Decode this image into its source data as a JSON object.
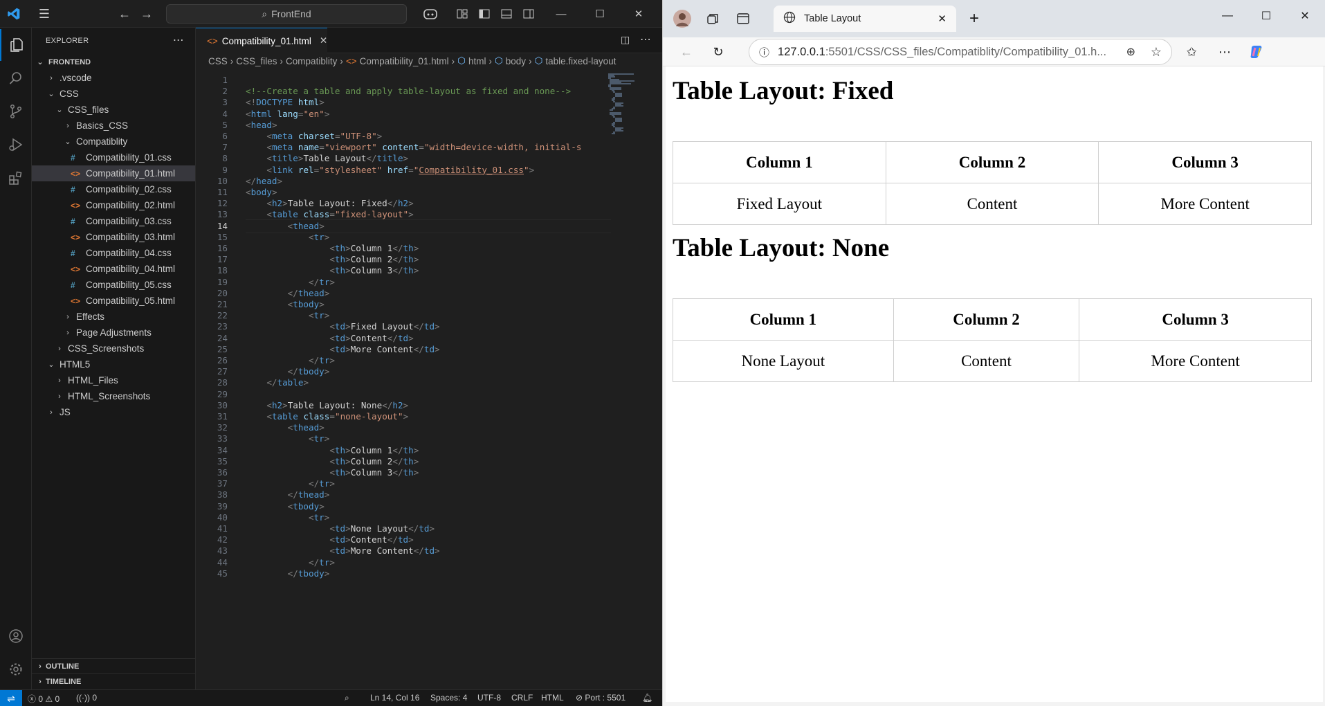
{
  "vscode": {
    "command_center": "FrontEnd",
    "explorer_title": "EXPLORER",
    "tree": [
      {
        "label": "FRONTEND",
        "level": 0,
        "type": "root",
        "chevron": "⌄"
      },
      {
        "label": ".vscode",
        "level": 1,
        "type": "folder",
        "chevron": "›"
      },
      {
        "label": "CSS",
        "level": 1,
        "type": "folder",
        "chevron": "⌄"
      },
      {
        "label": "CSS_files",
        "level": 2,
        "type": "folder",
        "chevron": "⌄"
      },
      {
        "label": "Basics_CSS",
        "level": 3,
        "type": "folder",
        "chevron": "›"
      },
      {
        "label": "Compatiblity",
        "level": 3,
        "type": "folder",
        "chevron": "⌄"
      },
      {
        "label": "Compatibility_01.css",
        "level": 4,
        "type": "css"
      },
      {
        "label": "Compatibility_01.html",
        "level": 4,
        "type": "html",
        "selected": true
      },
      {
        "label": "Compatibility_02.css",
        "level": 4,
        "type": "css"
      },
      {
        "label": "Compatibility_02.html",
        "level": 4,
        "type": "html"
      },
      {
        "label": "Compatibility_03.css",
        "level": 4,
        "type": "css"
      },
      {
        "label": "Compatibility_03.html",
        "level": 4,
        "type": "html"
      },
      {
        "label": "Compatibility_04.css",
        "level": 4,
        "type": "css"
      },
      {
        "label": "Compatibility_04.html",
        "level": 4,
        "type": "html"
      },
      {
        "label": "Compatibility_05.css",
        "level": 4,
        "type": "css"
      },
      {
        "label": "Compatibility_05.html",
        "level": 4,
        "type": "html"
      },
      {
        "label": "Effects",
        "level": 3,
        "type": "folder",
        "chevron": "›"
      },
      {
        "label": "Page Adjustments",
        "level": 3,
        "type": "folder",
        "chevron": "›"
      },
      {
        "label": "CSS_Screenshots",
        "level": 2,
        "type": "folder",
        "chevron": "›"
      },
      {
        "label": "HTML5",
        "level": 1,
        "type": "folder",
        "chevron": "⌄"
      },
      {
        "label": "HTML_Files",
        "level": 2,
        "type": "folder",
        "chevron": "›"
      },
      {
        "label": "HTML_Screenshots",
        "level": 2,
        "type": "folder",
        "chevron": "›"
      },
      {
        "label": "JS",
        "level": 1,
        "type": "folder",
        "chevron": "›"
      }
    ],
    "outline_label": "OUTLINE",
    "timeline_label": "TIMELINE",
    "tab_label": "Compatibility_01.html",
    "breadcrumbs": [
      "CSS",
      "CSS_files",
      "Compatiblity",
      "Compatibility_01.html",
      "html",
      "body",
      "table.fixed-layout"
    ],
    "current_line": 14,
    "code_lines": [
      "",
      "<!--Create a table and apply table-layout as fixed and none-->",
      "<!DOCTYPE html>",
      "<html lang=\"en\">",
      "<head>",
      "    <meta charset=\"UTF-8\">",
      "    <meta name=\"viewport\" content=\"width=device-width, initial-s",
      "    <title>Table Layout</title>",
      "    <link rel=\"stylesheet\" href=\"Compatibility_01.css\">",
      "</head>",
      "<body>",
      "    <h2>Table Layout: Fixed</h2>",
      "    <table class=\"fixed-layout\">",
      "        <thead>",
      "            <tr>",
      "                <th>Column 1</th>",
      "                <th>Column 2</th>",
      "                <th>Column 3</th>",
      "            </tr>",
      "        </thead>",
      "        <tbody>",
      "            <tr>",
      "                <td>Fixed Layout</td>",
      "                <td>Content</td>",
      "                <td>More Content</td>",
      "            </tr>",
      "        </tbody>",
      "    </table>",
      "",
      "    <h2>Table Layout: None</h2>",
      "    <table class=\"none-layout\">",
      "        <thead>",
      "            <tr>",
      "                <th>Column 1</th>",
      "                <th>Column 2</th>",
      "                <th>Column 3</th>",
      "            </tr>",
      "        </thead>",
      "        <tbody>",
      "            <tr>",
      "                <td>None Layout</td>",
      "                <td>Content</td>",
      "                <td>More Content</td>",
      "            </tr>",
      "        </tbody>"
    ],
    "status": {
      "errors": "0",
      "warnings": "0",
      "ports": "0",
      "position": "Ln 14, Col 16",
      "spaces": "Spaces: 4",
      "encoding": "UTF-8",
      "eol": "CRLF",
      "language": "HTML",
      "port": "Port : 5501"
    }
  },
  "edge": {
    "tab_title": "Table Layout",
    "url_host": "127.0.0.1",
    "url_rest": ":5501/CSS/CSS_files/Compatiblity/Compatibility_01.h...",
    "page": {
      "heading_fixed": "Table Layout: Fixed",
      "table_fixed": {
        "headers": [
          "Column 1",
          "Column 2",
          "Column 3"
        ],
        "row": [
          "Fixed Layout",
          "Content",
          "More Content"
        ]
      },
      "heading_none": "Table Layout: None",
      "table_none": {
        "headers": [
          "Column 1",
          "Column 2",
          "Column 3"
        ],
        "row": [
          "None Layout",
          "Content",
          "More Content"
        ]
      }
    }
  }
}
